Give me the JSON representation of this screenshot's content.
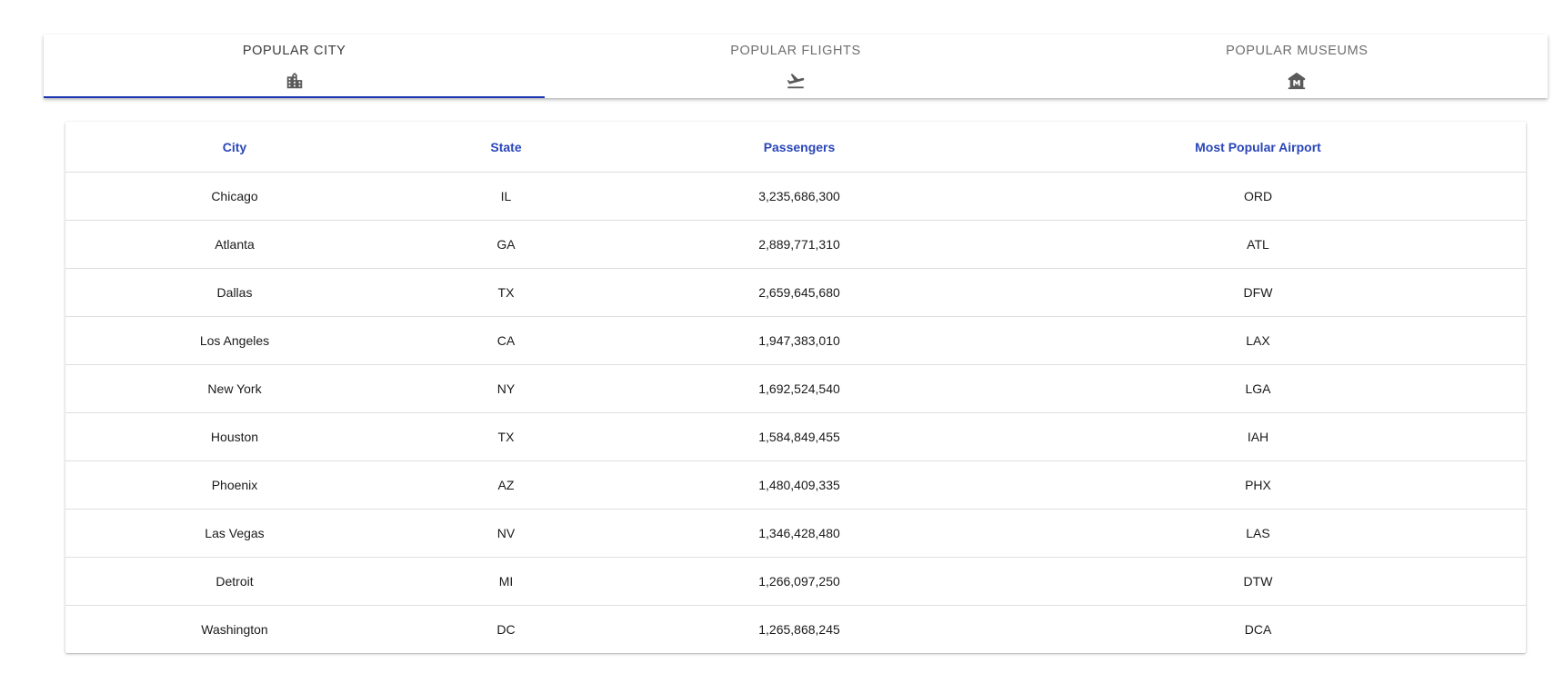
{
  "colors": {
    "accent": "#1d35b2",
    "header_text": "#2a46b8",
    "icon": "#5a5a5a"
  },
  "tabs": [
    {
      "label": "POPULAR CITY",
      "icon": "city-icon",
      "active": true
    },
    {
      "label": "POPULAR FLIGHTS",
      "icon": "flight-takeoff-icon",
      "active": false
    },
    {
      "label": "POPULAR MUSEUMS",
      "icon": "museum-icon",
      "active": false
    }
  ],
  "table": {
    "columns": [
      "City",
      "State",
      "Passengers",
      "Most Popular Airport"
    ],
    "rows": [
      [
        "Chicago",
        "IL",
        "3,235,686,300",
        "ORD"
      ],
      [
        "Atlanta",
        "GA",
        "2,889,771,310",
        "ATL"
      ],
      [
        "Dallas",
        "TX",
        "2,659,645,680",
        "DFW"
      ],
      [
        "Los Angeles",
        "CA",
        "1,947,383,010",
        "LAX"
      ],
      [
        "New York",
        "NY",
        "1,692,524,540",
        "LGA"
      ],
      [
        "Houston",
        "TX",
        "1,584,849,455",
        "IAH"
      ],
      [
        "Phoenix",
        "AZ",
        "1,480,409,335",
        "PHX"
      ],
      [
        "Las Vegas",
        "NV",
        "1,346,428,480",
        "LAS"
      ],
      [
        "Detroit",
        "MI",
        "1,266,097,250",
        "DTW"
      ],
      [
        "Washington",
        "DC",
        "1,265,868,245",
        "DCA"
      ]
    ]
  }
}
